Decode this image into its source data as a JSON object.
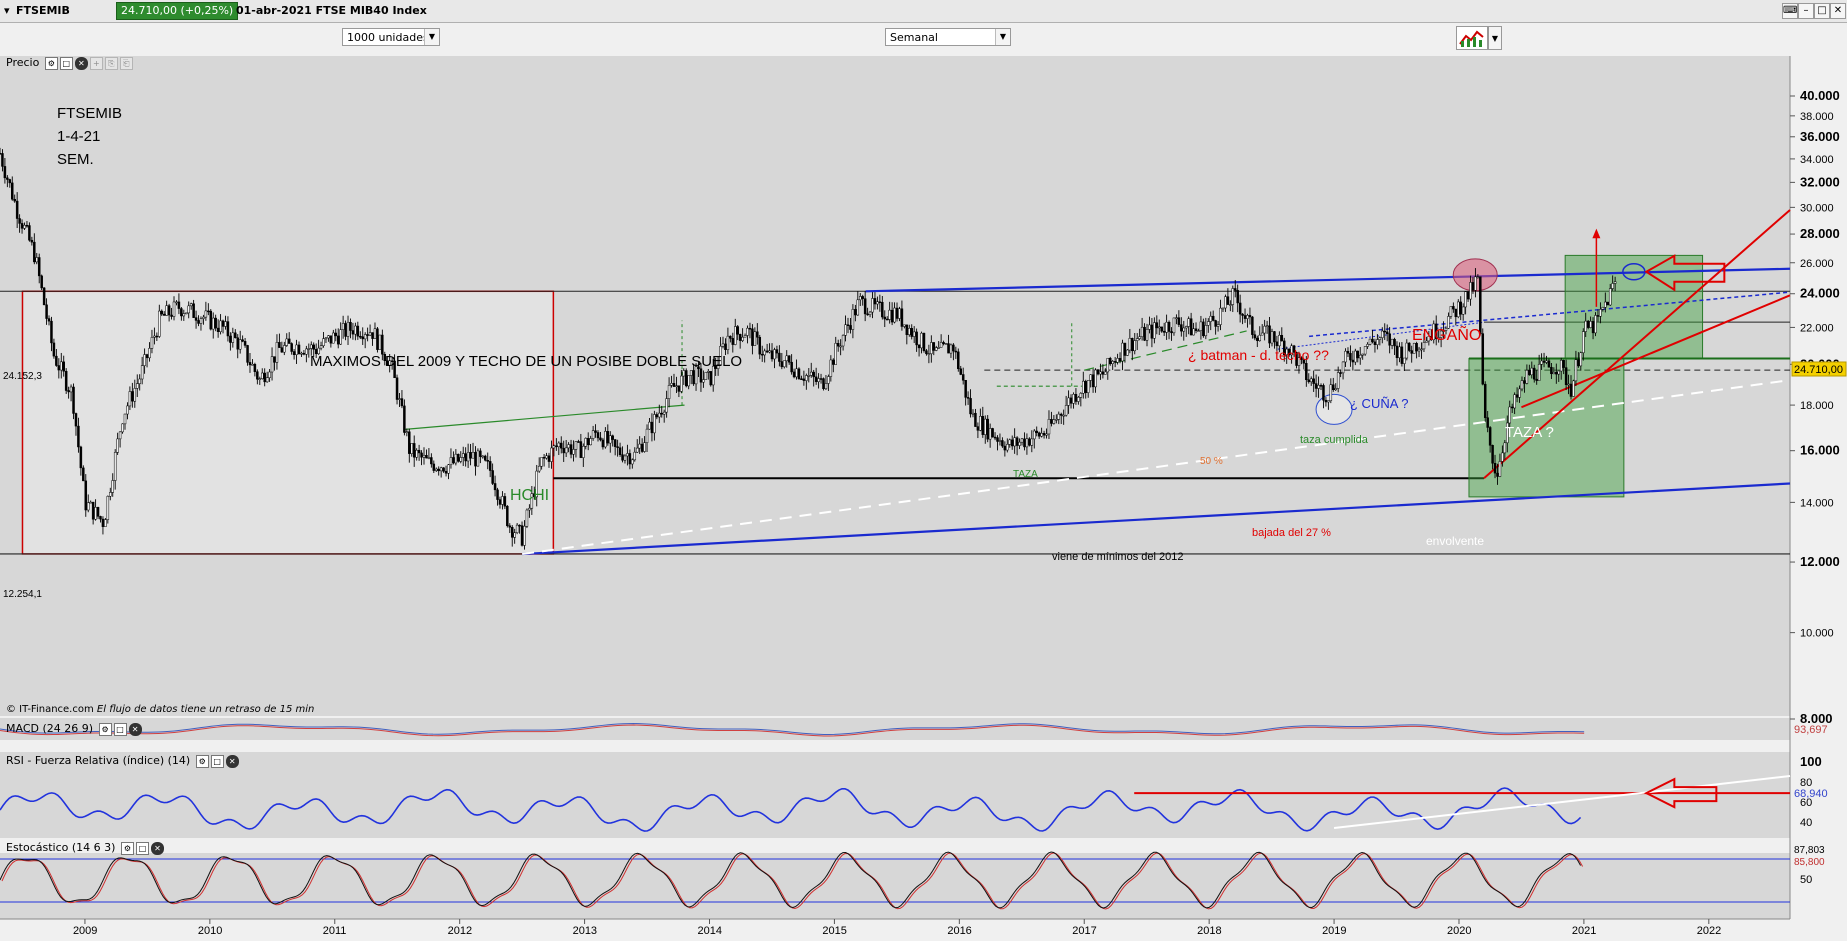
{
  "window": {
    "symbol": "FTSEMIB",
    "price_change": "24.710,00 (+0,25%)",
    "date_name": "01-abr-2021 FTSE MIB40 Index"
  },
  "toolbar": {
    "units": "1000 unidades",
    "period": "Semanal"
  },
  "panels": {
    "price": "Precio",
    "macd": "MACD (24 26 9)",
    "rsi": "RSI - Fuerza Relativa (índice) (14)",
    "stoch": "Estocástico (14 6 3)"
  },
  "credit": {
    "source": "© IT-Finance.com",
    "note": "El flujo de datos tiene un retraso de 15 min"
  },
  "chart_data": {
    "type": "candlestick",
    "instrument": "FTSE MIB40 Index",
    "interval": "Semanal",
    "x_labels": [
      "2009",
      "2010",
      "2011",
      "2012",
      "2013",
      "2014",
      "2015",
      "2016",
      "2017",
      "2018",
      "2019",
      "2020",
      "2021",
      "2022"
    ],
    "xlim": [
      2008.32,
      2022.65
    ],
    "y_ticks": [
      "40.000",
      "38.000",
      "36.000",
      "34.000",
      "32.000",
      "30.000",
      "28.000",
      "26.000",
      "24.000",
      "22.000",
      "20.000",
      "18.000",
      "16.000",
      "14.000",
      "12.000",
      "10.000",
      "8.000"
    ],
    "y_scale": "log",
    "last_price_label": "24.710,00",
    "left_levels": [
      "24.152,3",
      "12.254,1"
    ],
    "close_series": {
      "x": [
        2008.32,
        2008.45,
        2008.6,
        2008.75,
        2008.9,
        2009.0,
        2009.15,
        2009.3,
        2009.45,
        2009.6,
        2009.75,
        2009.9,
        2010.1,
        2010.25,
        2010.4,
        2010.55,
        2010.7,
        2010.85,
        2011.0,
        2011.15,
        2011.3,
        2011.45,
        2011.6,
        2011.75,
        2011.9,
        2012.1,
        2012.25,
        2012.4,
        2012.5,
        2012.65,
        2012.8,
        2012.95,
        2013.1,
        2013.25,
        2013.4,
        2013.55,
        2013.7,
        2013.85,
        2014.0,
        2014.15,
        2014.3,
        2014.45,
        2014.6,
        2014.75,
        2014.9,
        2015.05,
        2015.2,
        2015.35,
        2015.5,
        2015.65,
        2015.8,
        2015.95,
        2016.1,
        2016.25,
        2016.4,
        2016.55,
        2016.7,
        2016.85,
        2017.0,
        2017.15,
        2017.3,
        2017.45,
        2017.6,
        2017.75,
        2017.9,
        2018.05,
        2018.2,
        2018.35,
        2018.5,
        2018.65,
        2018.8,
        2018.95,
        2019.1,
        2019.25,
        2019.4,
        2019.55,
        2019.7,
        2019.85,
        2020.0,
        2020.1,
        2020.15,
        2020.2,
        2020.3,
        2020.4,
        2020.55,
        2020.7,
        2020.8,
        2020.9,
        2021.0,
        2021.1,
        2021.25
      ],
      "y": [
        34500,
        30000,
        26500,
        20500,
        18500,
        14000,
        13300,
        17500,
        19500,
        22500,
        23200,
        22800,
        22000,
        21000,
        19200,
        20800,
        21000,
        20800,
        21500,
        22000,
        21800,
        20000,
        16000,
        15500,
        15400,
        15800,
        15200,
        13200,
        12800,
        15500,
        16300,
        16000,
        16800,
        16000,
        15800,
        17200,
        18800,
        19500,
        19200,
        21500,
        21800,
        20500,
        20200,
        19500,
        19000,
        21300,
        23500,
        23000,
        22800,
        21500,
        20500,
        21000,
        17500,
        16800,
        16200,
        16500,
        16800,
        18000,
        19000,
        19500,
        20800,
        21500,
        22000,
        22300,
        21800,
        22500,
        23900,
        21800,
        21500,
        20800,
        19200,
        18500,
        20300,
        21000,
        21500,
        20500,
        21300,
        22000,
        23200,
        24200,
        25000,
        17500,
        15000,
        17500,
        19500,
        19800,
        20000,
        18800,
        21800,
        22200,
        24710
      ]
    },
    "annotations": [
      "FTSEMIB",
      "1-4-21",
      "SEM.",
      "MAXIMOS DEL 2009 Y TECHO DE UN POSIBE DOBLE SUELO",
      "HCHI",
      "TAZA",
      "50 %",
      "¿ batman - d. techo ??",
      "ENGAÑO",
      "¿ CUÑA ?",
      "taza cumplida",
      "TAZA ?",
      "bajada del 27 %",
      "viene de mínimos del  2012",
      "envolvente"
    ],
    "macd": {
      "last_value": "93,697"
    },
    "rsi": {
      "y_ticks": [
        "100",
        "80",
        "60",
        "40"
      ],
      "last_value": "68,940"
    },
    "stochastic": {
      "y_ticks": [
        "50"
      ],
      "last_values": [
        "87,803",
        "85,800"
      ]
    }
  }
}
